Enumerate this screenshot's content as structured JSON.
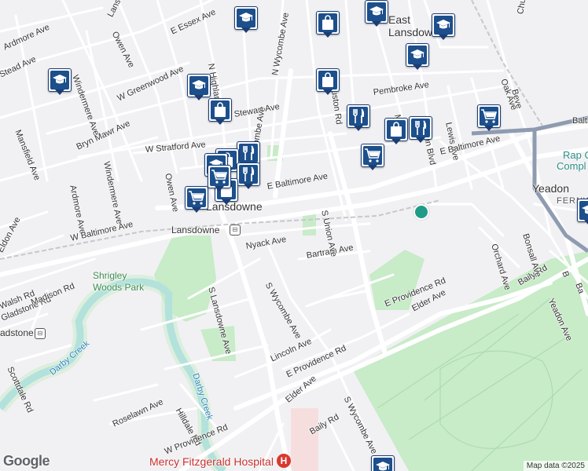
{
  "streets": [
    "Lansdowne Ave",
    "N Highland Ave",
    "E Essex Ave",
    "Owen Ave",
    "Ardmore Ave",
    "Windermere Ave",
    "Stead Ave",
    "W Greenwood Ave",
    "Pembroke Ave",
    "N Wycombe Ave",
    "Stewart Ave",
    "Mansfield Ave",
    "Bryn Mawr Ave",
    "W Stratford Ave",
    "Windermere Ave",
    "Ardmore Ave",
    "Owen Ave",
    "N Wycombe Ave",
    "E Baltimore Ave",
    "W Baltimore Ave",
    "Eldon Ave",
    "Lansdowne",
    "Nyack Ave",
    "S Lansdowne Ave",
    "S Wycombe Ave",
    "Bartram Ave",
    "S Union Ave",
    "Houston Rd",
    "Penn Blvd",
    "Lewis Ave",
    "E Baltimore Ave",
    "Baltimore",
    "Walsh Rd",
    "Gladstone Rd",
    "Madison Rd",
    "Scottdale Rd",
    "Lincoln Ave",
    "E Providence Rd",
    "Elder Ave",
    "Baily Rd",
    "Hilldale Rd",
    "Roselawn Ave",
    "W Providence Rd",
    "S Wycombe Ave",
    "Elder Ave",
    "E Providence Rd",
    "Baily Rd",
    "Bonsall Ave",
    "Orchard Ave",
    "Yeadon Ave",
    "Oak Ave",
    "Church",
    "Beve",
    "Me",
    "Ba",
    "B",
    "Darby Creek",
    "Darby Creek",
    "adstone"
  ],
  "places": {
    "east_lansdowne": "East Lansdowne",
    "yeadon": "Yeadon",
    "fernwood": "FERNW",
    "lansdowne_town": "Lansdowne",
    "lansdowne_station": "Lansdowne",
    "shrigley": "Shrigley Woods Park",
    "rap": "Rap C",
    "compl": "Compl",
    "hospital": "Mercy Fitzgerald Hospital"
  },
  "pins": [
    {
      "icon": "school-icon"
    },
    {
      "icon": "shopping-bag-icon"
    },
    {
      "icon": "school-icon"
    },
    {
      "icon": "school-icon"
    },
    {
      "icon": "school-icon"
    },
    {
      "icon": "school-icon"
    },
    {
      "icon": "shopping-bag-icon"
    },
    {
      "icon": "school-icon"
    },
    {
      "icon": "shopping-bag-icon"
    },
    {
      "icon": "restaurant-icon"
    },
    {
      "icon": "shopping-bag-icon"
    },
    {
      "icon": "restaurant-icon"
    },
    {
      "icon": "cart-icon"
    },
    {
      "icon": "cart-icon"
    },
    {
      "icon": "restaurant-icon"
    },
    {
      "icon": "shopping-bag-icon"
    },
    {
      "icon": "school-icon"
    },
    {
      "icon": "restaurant-icon"
    },
    {
      "icon": "cart-icon"
    },
    {
      "icon": "shopping-bag-icon"
    },
    {
      "icon": "cart-icon"
    },
    {
      "icon": "school-icon"
    },
    {
      "icon": "school-icon"
    }
  ],
  "attribution": "Map data ©2025",
  "google": "Google",
  "colors": {
    "pin": "#1c4f8c",
    "park": "#c8ebc8",
    "water": "#9fd6ee",
    "road": "#ffffff",
    "highway": "#8e9bb0"
  }
}
